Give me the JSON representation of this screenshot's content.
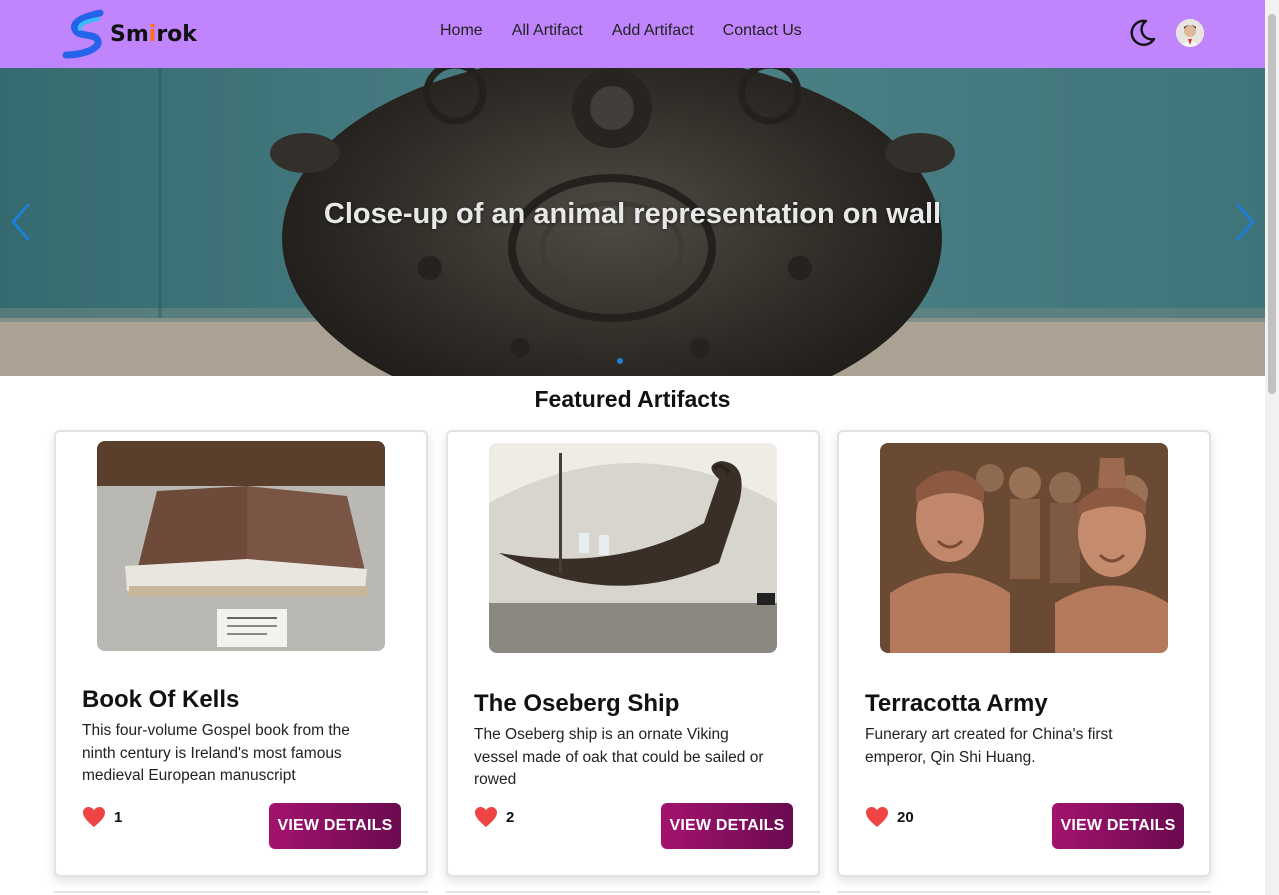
{
  "brand": {
    "name_part1": "Sm",
    "name_accent": "i",
    "name_part2": "rok"
  },
  "nav": {
    "links": [
      "Home",
      "All Artifact",
      "Add Artifact",
      "Contact Us"
    ],
    "theme_toggle_icon": "moon-icon",
    "avatar_icon": "user-avatar"
  },
  "hero": {
    "caption": "Close-up of an animal representation on wall",
    "prev_icon": "chevron-left-icon",
    "next_icon": "chevron-right-icon",
    "active_slide": 1
  },
  "featured": {
    "title": "Featured Artifacts",
    "cards": [
      {
        "title": "Book Of Kells",
        "description": "This four-volume Gospel book from the ninth century is Ireland's most famous medieval European manuscript",
        "likes": "1",
        "button": "VIEW DETAILS",
        "image_icon": "book-image"
      },
      {
        "title": "The Oseberg Ship",
        "description": "The Oseberg ship is an ornate Viking vessel made of oak that could be sailed or rowed",
        "likes": "2",
        "button": "VIEW DETAILS",
        "image_icon": "ship-image"
      },
      {
        "title": "Terracotta Army",
        "description": "Funerary art created for China's first emperor, Qin Shi Huang.",
        "likes": "20",
        "button": "VIEW DETAILS",
        "image_icon": "statues-image"
      }
    ]
  },
  "colors": {
    "navbar": "#c084fc",
    "button_start": "#a3136e",
    "button_end": "#6a0a4f",
    "heart": "#ef4444",
    "carousel_accent": "#1d7ed8"
  }
}
